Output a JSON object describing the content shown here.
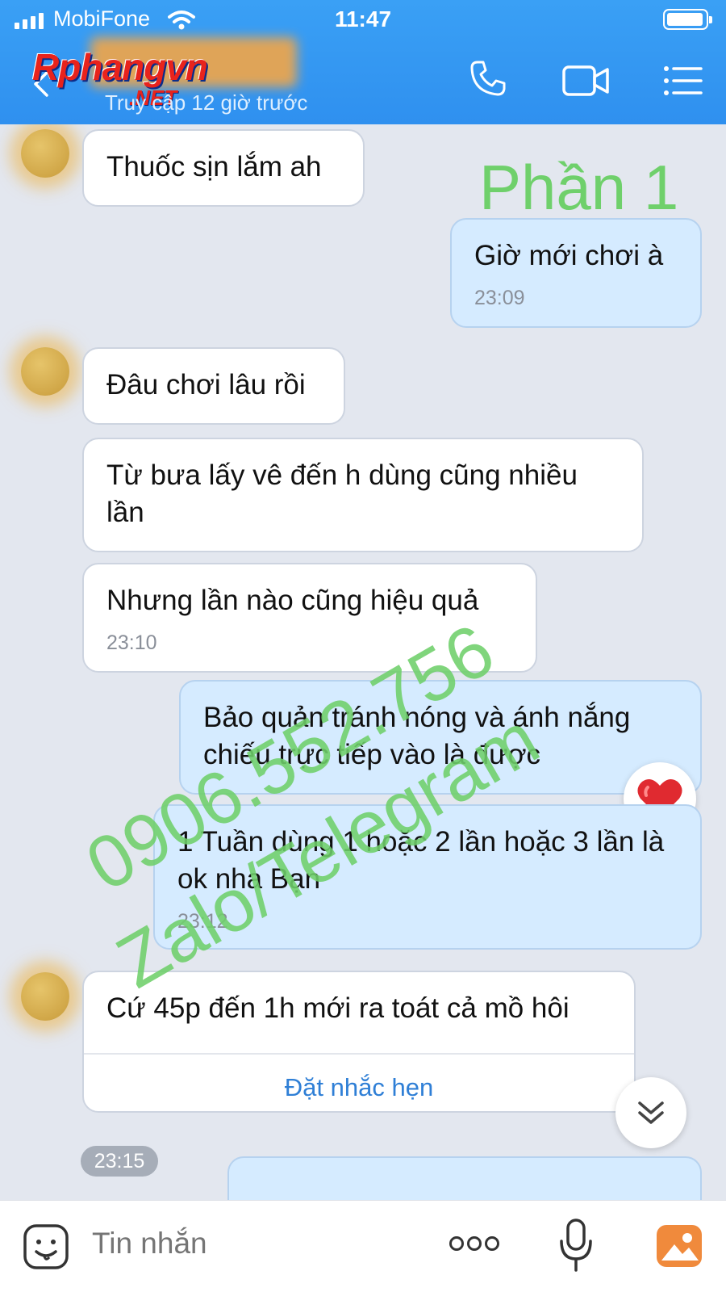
{
  "status": {
    "carrier": "MobiFone",
    "time": "11:47"
  },
  "header": {
    "last_seen": "Truy cập 12 giờ trước",
    "watermark_logo": "Rphangvn",
    "watermark_net": ".NET"
  },
  "chat": {
    "part_label": "Phần 1",
    "messages": [
      {
        "dir": "in",
        "text": "Thuốc sịn lắm ah"
      },
      {
        "dir": "out",
        "text": "Giờ mới chơi à",
        "time": "23:09"
      },
      {
        "dir": "in",
        "text": "Đâu chơi lâu rồi"
      },
      {
        "dir": "in",
        "text": "Từ bưa lấy vê đến h dùng cũng nhiều lần"
      },
      {
        "dir": "in",
        "text": "Nhưng lần nào cũng hiệu quả",
        "time": "23:10"
      },
      {
        "dir": "out",
        "text": "Bảo quản tránh nóng và ánh nắng chiếu trực tiếp vào là được"
      },
      {
        "dir": "out",
        "text": "1 Tuần dùng 1 hoặc 2 lần hoặc 3 lần là ok nha Bạn",
        "time": "23:12"
      },
      {
        "dir": "in",
        "text": "Cứ 45p đến 1h mới ra toát cả mồ hôi",
        "action": "Đặt nhắc hẹn"
      }
    ],
    "time_pill": "23:15",
    "reaction_icon": "heart-icon",
    "overlay_phone": "0906.552.756",
    "overlay_contact": "Zalo/Telegram"
  },
  "input": {
    "placeholder": "Tin nhắn"
  },
  "colors": {
    "header": "#3aa0f5",
    "outgoing": "#d5ebff",
    "incoming": "#ffffff",
    "accent_green": "#6fd06b",
    "link": "#2f7fd6"
  }
}
